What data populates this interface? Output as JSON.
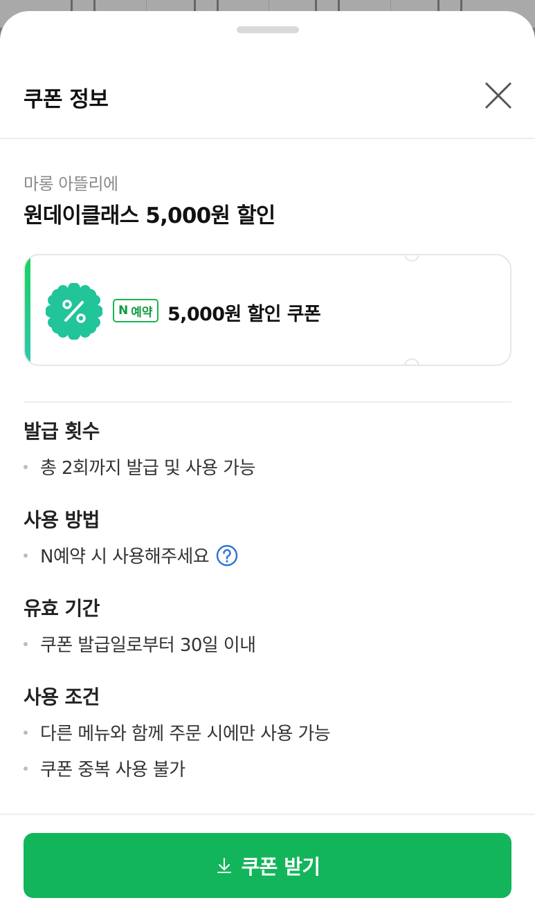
{
  "sheet": {
    "title": "쿠폰 정보",
    "close_icon": "close-icon"
  },
  "coupon": {
    "store_name": "마롱 아뜰리에",
    "title": "원데이클래스 5,000원 할인",
    "badge_n": "N",
    "badge_text": "예약",
    "label": "5,000원 할인 쿠폰",
    "icon": "discount-percent-icon",
    "accent_colors": [
      "#19d25e",
      "#2ec7b0"
    ]
  },
  "sections": [
    {
      "heading": "발급 횟수",
      "items": [
        "총 2회까지 발급 및 사용 가능"
      ]
    },
    {
      "heading": "사용 방법",
      "items": [
        "N예약 시 사용해주세요"
      ],
      "help_icon": "help-circle-icon"
    },
    {
      "heading": "유효 기간",
      "items": [
        "쿠폰 발급일로부터 30일 이내"
      ]
    },
    {
      "heading": "사용 조건",
      "items": [
        "다른 메뉴와 함께 주문 시에만 사용 가능",
        "쿠폰 중복 사용 불가"
      ]
    }
  ],
  "cta": {
    "label": "쿠폰 받기",
    "icon": "download-icon",
    "color": "#13b55b"
  }
}
